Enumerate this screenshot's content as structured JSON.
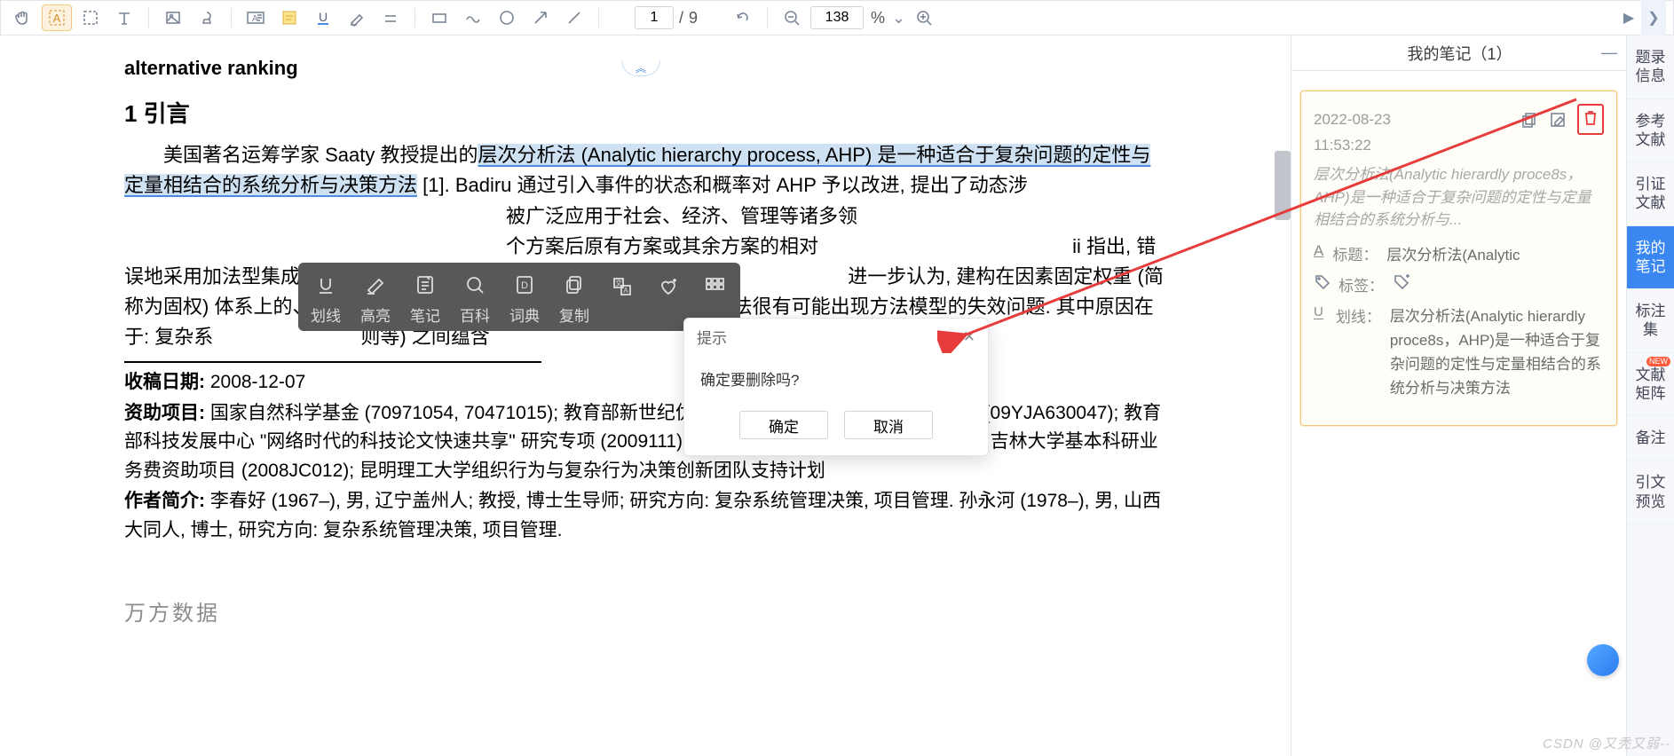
{
  "toolbar": {
    "page_current": "1",
    "page_total": "9",
    "zoom_value": "138",
    "zoom_pct": "%"
  },
  "collapse_glyph": "︽",
  "doc": {
    "alt": "alternative ranking",
    "h1": "1  引言",
    "p1a": "美国著名运筹学家 Saaty 教授提出的",
    "p1b": "层次分析法 (Analytic hierarchy process, AHP) 是一种适合于复杂问题的定性与定量相结合的系统分析与决策方法",
    "p1c": " [1]. Badiru 通过引入事件的状态和概率对 AHP 予以改进, 提出了动态涉",
    "p1d": "被广泛应用于社会、经济、管理等诸多领",
    "p1e": "个方案后原有方案或其余方案的相对",
    "p1f": "ii 指出, 错误地采用加法型集成函数是导致传统 AHP 出现逆序问题的一个重",
    "p1g": "进一步认为, 建构在因素固定权重 (简称为固权) 体系上的、反映系统要素相",
    "p1h": "了案复合排序方法很有可能出现方法模型的失效问题. 其中原因在于: 复杂系",
    "p1i": "则等) 之间蕴含",
    "date_label": "收稿日期:",
    "date_val": " 2008-12-07",
    "fund_label": "资助项目:",
    "fund_val": " 国家自然科学基金 (70971054, 70471015); 教育部新世纪优秀                                育部人文社会科学研究规划项目 (09YJA630047); 教育部科技发展中心 \"网络时代的科技论文快速共享\" 研究专项 (2009111); 吉林省软科学研究项目 (20080610); 吉林大学基本科研业务费资助项目 (2008JC012); 昆明理工大学组织行为与复杂行为决策创新团队支持计划",
    "author_label": "作者简介:",
    "author_val": " 李春好 (1967–), 男, 辽宁盖州人; 教授, 博士生导师; 研究方向: 复杂系统管理决策, 项目管理. 孙永河 (1978–), 男, 山西大同人, 博士, 研究方向: 复杂系统管理决策, 项目管理.",
    "wm": "万方数据"
  },
  "ctx": {
    "underline": "划线",
    "highlight": "高亮",
    "note": "笔记",
    "baike": "百科",
    "dict": "词典",
    "copy": "复制"
  },
  "dlg": {
    "title": "提示",
    "body": "确定要删除吗?",
    "ok": "确定",
    "cancel": "取消"
  },
  "notes": {
    "title": "我的笔记（1）",
    "date": "2022-08-23",
    "time": "11:53:22",
    "excerpt": "层次分析法(Analytic hierardly proce8s，AHP)是一种适合于复杂问题的定性与定量相结合的系统分析与...",
    "f_title_lab": "标题：",
    "f_title_val": "层次分析法(Analytic",
    "f_tag_lab": "标签：",
    "f_ul_lab": "划线：",
    "f_ul_val": "层次分析法(Analytic hierardly proce8s，AHP)是一种适合于复杂问题的定性与定量相结合的系统分析与决策方法",
    "ul_glyph": "U"
  },
  "tabs": {
    "t1": "题录信息",
    "t2": "参考文献",
    "t3": "引证文献",
    "t4": "我的笔记",
    "t5": "标注集",
    "t6": "文献矩阵",
    "t7": "备注",
    "t8": "引文预览",
    "new": "NEW"
  },
  "watermark": "CSDN @又秃又弱--"
}
